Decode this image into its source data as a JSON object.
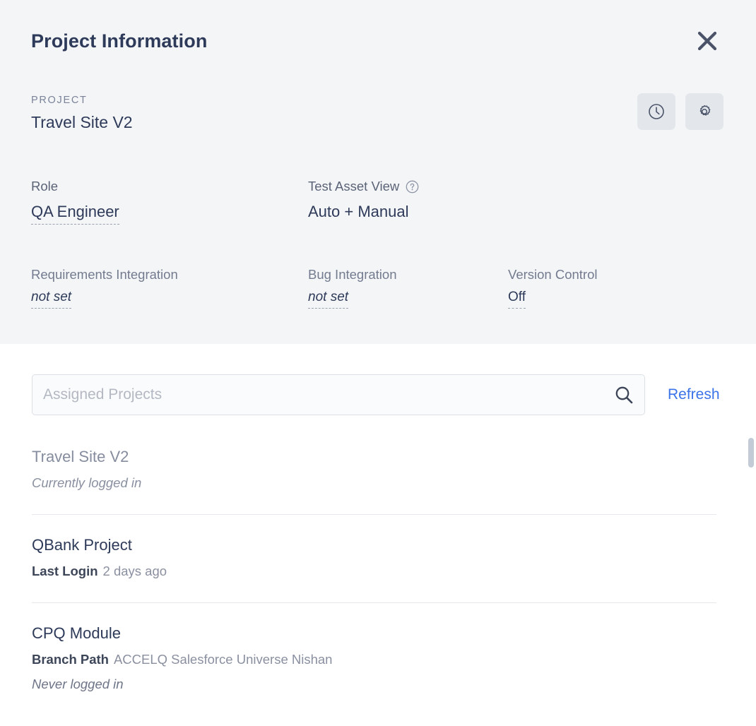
{
  "dialog": {
    "title": "Project Information",
    "close_icon": "close-icon"
  },
  "project_section": {
    "eyebrow": "PROJECT",
    "name": "Travel Site V2",
    "actions": [
      {
        "icon": "clock-icon",
        "name": "history-button"
      },
      {
        "icon": "gear-icon",
        "name": "settings-button"
      }
    ]
  },
  "fields": {
    "role": {
      "label": "Role",
      "value": "QA Engineer"
    },
    "test_asset_view": {
      "label": "Test Asset View",
      "value": "Auto + Manual",
      "help_icon": "help-circle-icon"
    },
    "requirements_integration": {
      "label": "Requirements Integration",
      "value": "not set"
    },
    "bug_integration": {
      "label": "Bug Integration",
      "value": "not set"
    },
    "version_control": {
      "label": "Version Control",
      "value": "Off"
    }
  },
  "search": {
    "placeholder": "Assigned Projects",
    "value": "",
    "icon": "search-icon",
    "refresh_label": "Refresh"
  },
  "projects": [
    {
      "name": "Travel Site V2",
      "status": "Currently logged in",
      "status_style": "italic",
      "muted": true
    },
    {
      "name": "QBank Project",
      "meta_key": "Last Login",
      "meta_value": "2 days ago"
    },
    {
      "name": "CPQ Module",
      "meta_key": "Branch Path",
      "meta_value": "ACCELQ Salesforce Universe Nishan",
      "status": "Never logged in"
    }
  ],
  "colors": {
    "panel_bg": "#f4f5f7",
    "text_dark": "#2e3a59",
    "text_muted": "#737b8f",
    "link_blue": "#3b73e8",
    "icon_btn_bg": "#e3e6eb",
    "divider": "#e6e8eb"
  }
}
